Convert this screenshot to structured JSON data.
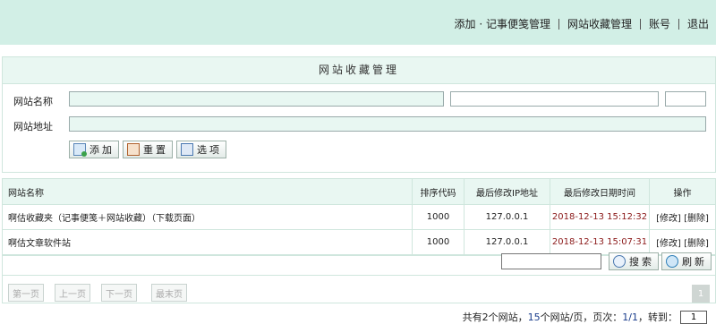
{
  "topnav": {
    "add_notes": "添加 · 记事便笺管理",
    "site_fav": "网站收藏管理",
    "account": "账号",
    "logout": "退出"
  },
  "form": {
    "title": "网站收藏管理",
    "site_name_label": "网站名称",
    "site_url_label": "网站地址",
    "site_name_value": "",
    "field2_value": "",
    "field3_value": "",
    "site_url_value": "",
    "buttons": {
      "add": "添加",
      "reset": "重置",
      "options": "选项"
    }
  },
  "table": {
    "headers": [
      "网站名称",
      "排序代码",
      "最后修改IP地址",
      "最后修改日期时间",
      "操作"
    ],
    "rows": [
      {
        "name": "啊估收藏夹（记事便笺＋网站收藏）（下载页面）",
        "order": "1000",
        "ip": "127.0.0.1",
        "date": "2018-12-13 15:12:32",
        "edit": "[修改]",
        "delete": "[删除]"
      },
      {
        "name": "啊估文章软件站",
        "order": "1000",
        "ip": "127.0.0.1",
        "date": "2018-12-13 15:07:31",
        "edit": "[修改]",
        "delete": "[删除]"
      }
    ]
  },
  "search": {
    "value": "",
    "search_label": "搜索",
    "refresh_label": "刷新"
  },
  "pager": {
    "first": "第一页",
    "prev": "上一页",
    "next": "下一页",
    "last": "最末页",
    "current_page_badge": "1",
    "status_prefix": "共有",
    "total": "2",
    "status_mid1": "个网站，",
    "per_page": "15",
    "status_mid2": "个网站/页，页次：",
    "page_of": "1/1",
    "status_mid3": "，转到：",
    "goto_value": "1"
  },
  "colors": {
    "header_bg": "#d2efe6",
    "panel_bg": "#e9f7f2",
    "date_red": "#8b1a1a"
  }
}
